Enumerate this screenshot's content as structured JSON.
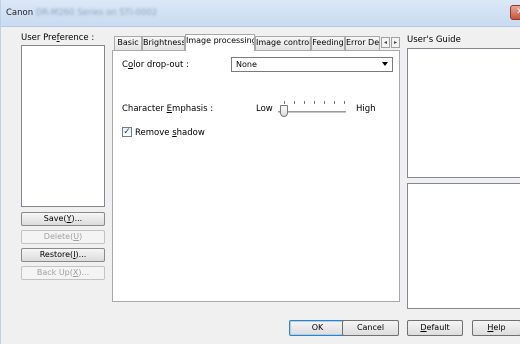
{
  "window": {
    "title_visible": "Canon",
    "title_obscured": "DR-M260 Series on STI-0002",
    "close_label": "✕"
  },
  "left": {
    "heading": "User Preference :",
    "buttons": [
      {
        "label": "Save(Y)...",
        "enabled": true
      },
      {
        "label": "Delete(U)",
        "enabled": false
      },
      {
        "label": "Restore(I)...",
        "enabled": true
      },
      {
        "label": "Back Up(X)...",
        "enabled": false
      }
    ]
  },
  "tabs": [
    {
      "label": "Basic",
      "active": false
    },
    {
      "label": "Brightness",
      "active": false
    },
    {
      "label": "Image processing",
      "active": true
    },
    {
      "label": "Image control",
      "active": false
    },
    {
      "label": "Feeding",
      "active": false
    },
    {
      "label": "Error De",
      "active": false
    }
  ],
  "tab_scroll": {
    "left": "◂",
    "right": "▸"
  },
  "image_processing": {
    "color_dropout_label": "Color drop-out :",
    "color_dropout_value": "None",
    "char_emphasis_label": "Character Emphasis :",
    "slider_low": "Low",
    "slider_high": "High",
    "slider_level": 0,
    "remove_shadow_label": "Remove shadow",
    "remove_shadow_checked": true,
    "check_glyph": "✓"
  },
  "guide": {
    "heading": "User's Guide"
  },
  "footer": {
    "ok": "OK",
    "cancel": "Cancel",
    "default": "Default",
    "help": "Help"
  }
}
